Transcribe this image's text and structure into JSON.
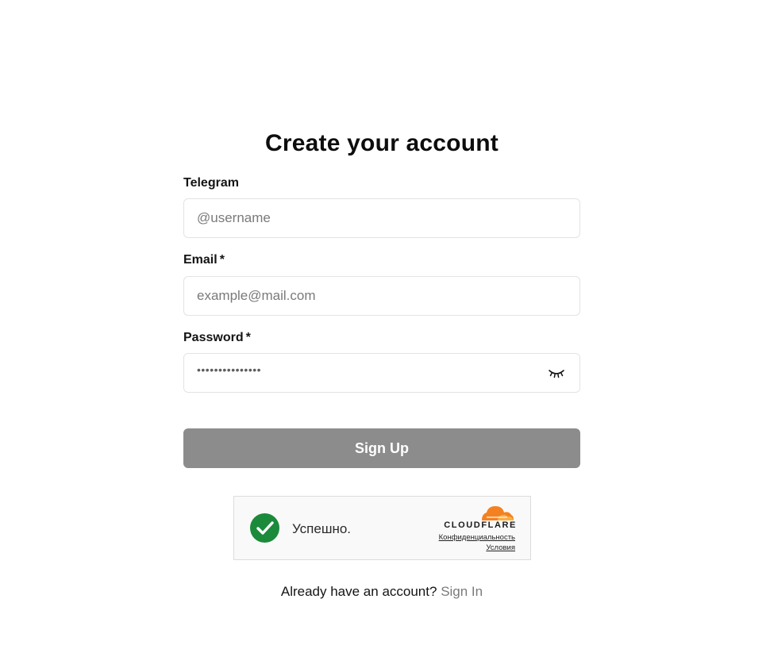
{
  "header": {
    "title": "Create your account"
  },
  "form": {
    "telegram": {
      "label": "Telegram",
      "placeholder": "@username"
    },
    "email": {
      "label": "Email",
      "required_mark": "*",
      "placeholder": "example@mail.com"
    },
    "password": {
      "label": "Password",
      "required_mark": "*",
      "masked_value": "•••••••••••••••",
      "toggle_icon": "eye-closed-icon"
    },
    "submit_label": "Sign Up"
  },
  "captcha": {
    "status_text": "Успешно.",
    "status_icon": "check-circle-icon",
    "brand": "CLOUDFLARE",
    "privacy_link": "Конфиденциальность",
    "terms_link": "Условия"
  },
  "footer": {
    "prompt": "Already have an account?",
    "signin_link": "Sign In"
  },
  "colors": {
    "button_bg": "#8c8c8c",
    "check_green": "#1b8a3a",
    "cloudflare_orange": "#f48120"
  }
}
